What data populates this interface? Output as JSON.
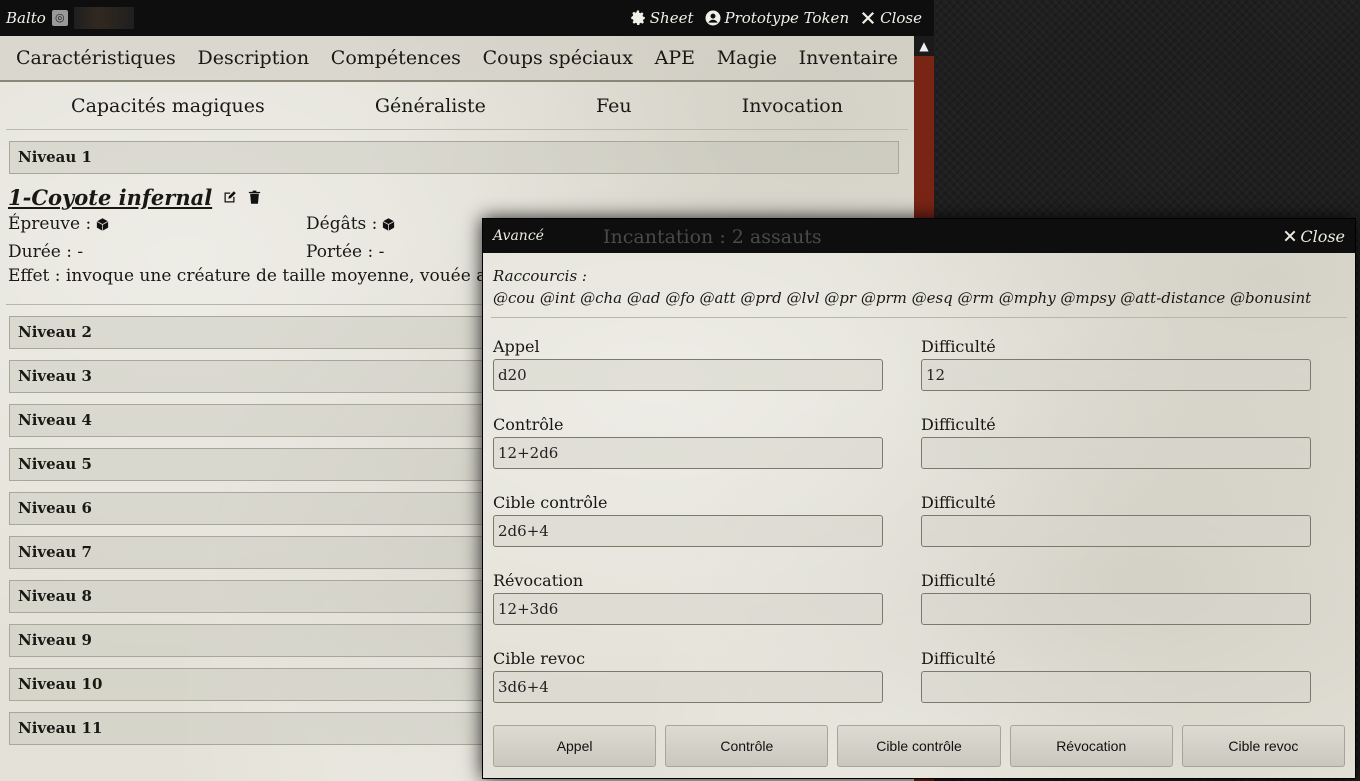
{
  "header": {
    "title": "Balto",
    "controls": [
      {
        "label": "Sheet",
        "icon": "gear-icon"
      },
      {
        "label": "Prototype Token",
        "icon": "user-circle-icon"
      },
      {
        "label": "Close",
        "icon": "close-icon"
      }
    ]
  },
  "tabs": [
    "Caractéristiques",
    "Description",
    "Compétences",
    "Coups spéciaux",
    "APE",
    "Magie",
    "Inventaire"
  ],
  "subtabs": [
    "Capacités magiques",
    "Généraliste",
    "Feu",
    "Invocation"
  ],
  "levels": {
    "first": "Niveau 1",
    "rest": [
      "Niveau 2",
      "Niveau 3",
      "Niveau 4",
      "Niveau 5",
      "Niveau 6",
      "Niveau 7",
      "Niveau 8",
      "Niveau 9",
      "Niveau 10",
      "Niveau 11"
    ]
  },
  "spell": {
    "title": "1-Coyote infernal",
    "epreuve_label": "Épreuve :",
    "degats_label": "Dégâts :",
    "duree": "Durée : -",
    "portee": "Portée : -",
    "effet": "Effet : invoque une créature de taille moyenne, vouée au combat"
  },
  "dialog": {
    "title": "Avancé",
    "ghost_text": "Incantation : 2 assauts",
    "close_label": "Close",
    "shortcuts_label": "Raccourcis :",
    "shortcuts": "@cou @int @cha @ad @fo @att @prd @lvl @pr @prm @esq @rm @mphy @mpsy @att-distance @bonusint",
    "fields": [
      {
        "label": "Appel",
        "value": "d20",
        "diff_label": "Difficulté",
        "diff_value": "12"
      },
      {
        "label": "Contrôle",
        "value": "12+2d6",
        "diff_label": "Difficulté",
        "diff_value": ""
      },
      {
        "label": "Cible contrôle",
        "value": "2d6+4",
        "diff_label": "Difficulté",
        "diff_value": ""
      },
      {
        "label": "Révocation",
        "value": "12+3d6",
        "diff_label": "Difficulté",
        "diff_value": ""
      },
      {
        "label": "Cible revoc",
        "value": "3d6+4",
        "diff_label": "Difficulté",
        "diff_value": ""
      }
    ],
    "buttons": [
      "Appel",
      "Contrôle",
      "Cible contrôle",
      "Révocation",
      "Cible revoc"
    ]
  },
  "colors": {
    "header_bg": "#0e0e0e",
    "parchment": "#e4e2d8",
    "frame_red": "#7a2416"
  }
}
